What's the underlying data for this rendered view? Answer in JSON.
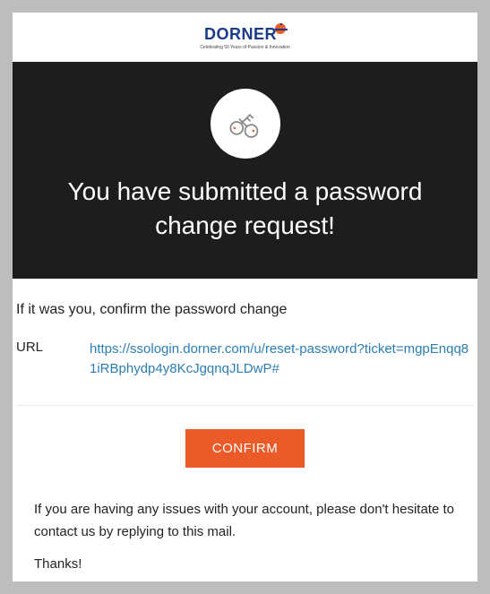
{
  "logo": {
    "brand": "DORNER",
    "tagline": "Celebrating 50 Years of Passion & Innovation"
  },
  "hero": {
    "headline": "You have submitted a password change request!"
  },
  "body": {
    "instruction": "If it was you, confirm the password change",
    "url_label": "URL",
    "url_value": "https://ssologin.dorner.com/u/reset-password?ticket=mgpEnqq81iRBphydp4y8KcJgqnqJLDwP#"
  },
  "button": {
    "confirm": "CONFIRM"
  },
  "footer": {
    "help": "If you are having any issues with your account, please don't hesitate to contact us by replying to this mail.",
    "thanks": "Thanks!"
  }
}
